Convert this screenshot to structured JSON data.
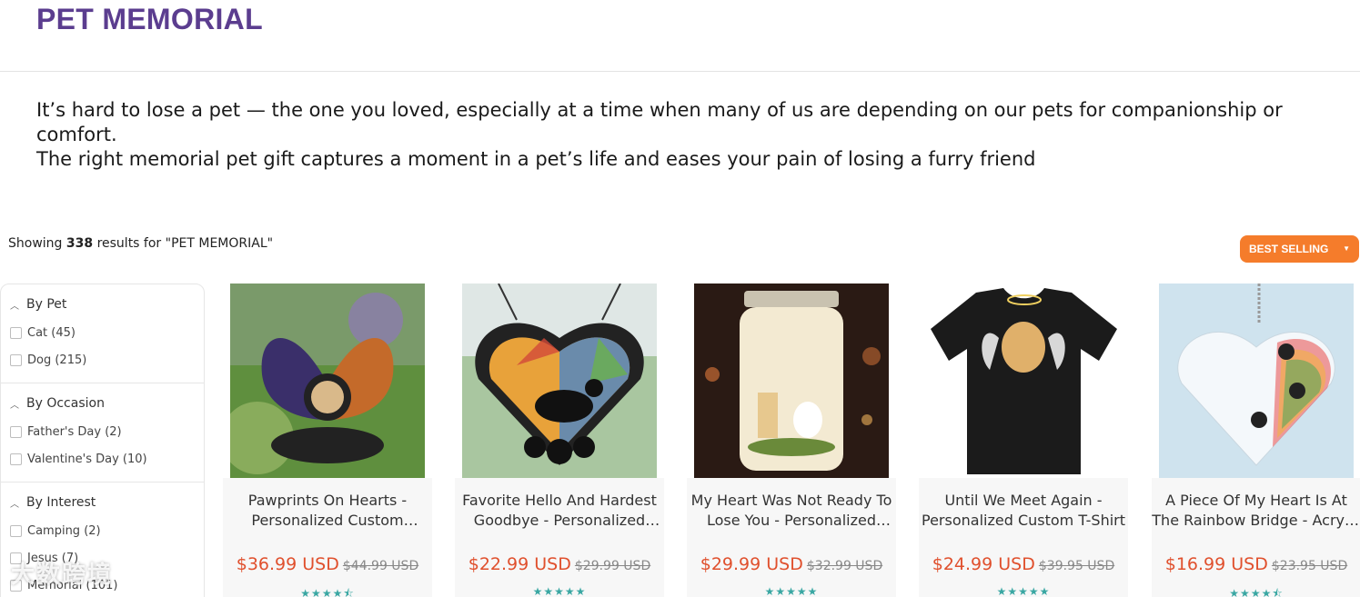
{
  "page": {
    "title": "PET MEMORIAL",
    "intro_line1": "It’s hard to lose a pet — the one you loved, especially at a time when many of us are depending on our pets for companionship or comfort.",
    "intro_line2": "The right memorial pet gift captures a moment in a pet’s life and eases your pain of losing a furry friend"
  },
  "results": {
    "prefix": "Showing",
    "count": "338",
    "suffix": "results for \"PET MEMORIAL\"",
    "sort_label": "BEST SELLING"
  },
  "filters": [
    {
      "label": "By Pet",
      "options": [
        "Cat (45)",
        "Dog (215)"
      ]
    },
    {
      "label": "By Occasion",
      "options": [
        "Father's Day (2)",
        "Valentine's Day (10)"
      ]
    },
    {
      "label": "By Interest",
      "options": [
        "Camping (2)",
        "Jesus (7)",
        "Memorial (101)"
      ]
    }
  ],
  "products": [
    {
      "title": "Pawprints On Hearts - Personalized Custom Memorial Solar Light",
      "price": "$36.99 USD",
      "compare": "$44.99 USD",
      "rating": 4.5,
      "stars": "★★★★⯪"
    },
    {
      "title": "Favorite Hello And Hardest Goodbye - Personalized Suncatcher",
      "price": "$22.99 USD",
      "compare": "$29.99 USD",
      "rating": 5,
      "stars": "★★★★★"
    },
    {
      "title": "My Heart Was Not Ready To Lose You - Personalized Mason Jar Light",
      "price": "$29.99 USD",
      "compare": "$32.99 USD",
      "rating": 5,
      "stars": "★★★★★"
    },
    {
      "title": "Until We Meet Again - Personalized Custom T-Shirt",
      "price": "$24.99 USD",
      "compare": "$39.95 USD",
      "rating": 5,
      "stars": "★★★★★"
    },
    {
      "title": "A Piece Of My Heart Is At The Rainbow Bridge - Acrylic Ornament",
      "price": "$16.99 USD",
      "compare": "$23.95 USD",
      "rating": 4.5,
      "stars": "★★★★⯪"
    }
  ],
  "watermark": "大数跨境",
  "colors": {
    "title": "#5b3d8f",
    "accent": "#f57c2b",
    "price": "#e0502d",
    "stars": "#3aa7a3"
  }
}
